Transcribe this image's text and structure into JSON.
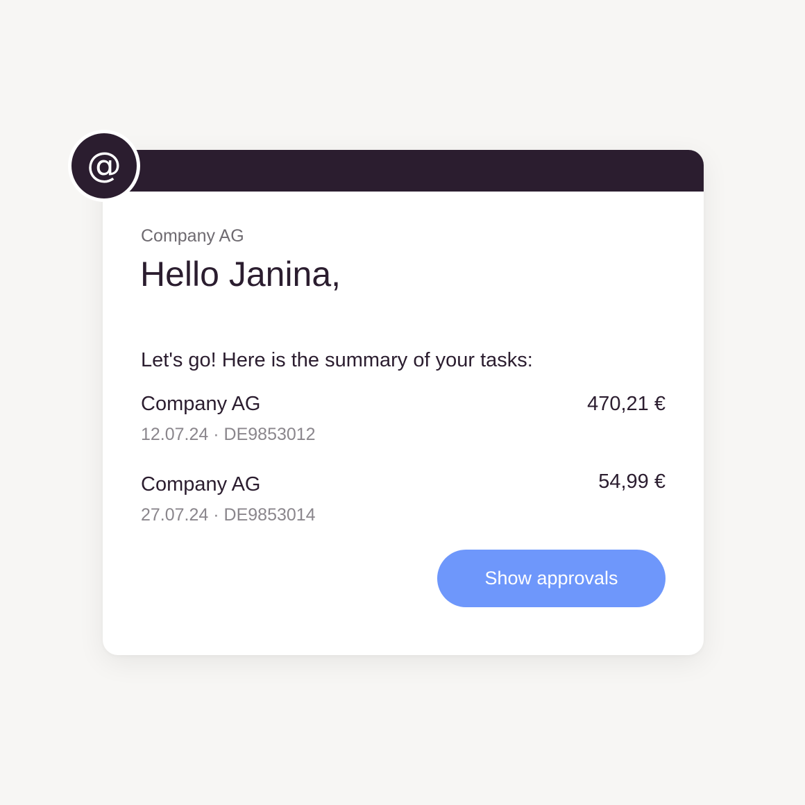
{
  "badge": {
    "icon": "at-sign-icon",
    "symbol": "@"
  },
  "email": {
    "sender": "Company AG",
    "greeting": "Hello Janina,",
    "intro": "Let's go! Here is the summary of your tasks:"
  },
  "tasks": [
    {
      "company": "Company AG",
      "meta": "12.07.24 · DE9853012",
      "amount": "470,21 €"
    },
    {
      "company": "Company AG",
      "meta": "27.07.24 · DE9853014",
      "amount": "54,99 €"
    }
  ],
  "actions": {
    "show_approvals_label": "Show approvals"
  },
  "colors": {
    "background": "#f7f6f4",
    "header": "#2b1d2f",
    "text": "#2b1d2f",
    "muted": "#8a868c",
    "button": "#6e97fb"
  }
}
